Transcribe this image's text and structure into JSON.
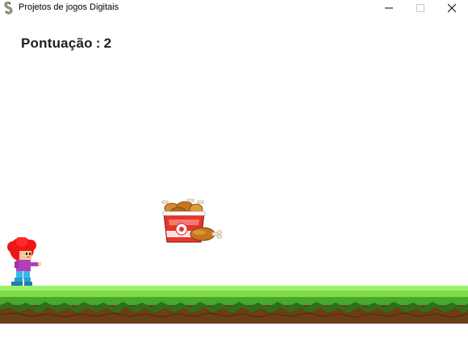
{
  "window": {
    "title": "Projetos de jogos Digitais",
    "icon": "pygame-snake-icon",
    "controls": [
      "minimize-icon",
      "maximize-icon",
      "close-icon"
    ]
  },
  "hud": {
    "score_label": "Pontuação",
    "score_separator": ":",
    "score_value": "2"
  },
  "sprites": {
    "player": "red-haired-character",
    "collectible": "fried-chicken-bucket",
    "terrain": "grass-dirt-ground"
  },
  "colors": {
    "background": "#ffffff",
    "grass_light": "#8ee65a",
    "grass_dark": "#4aa82c",
    "dirt": "#6b3f16",
    "text": "#1e1e1e"
  }
}
